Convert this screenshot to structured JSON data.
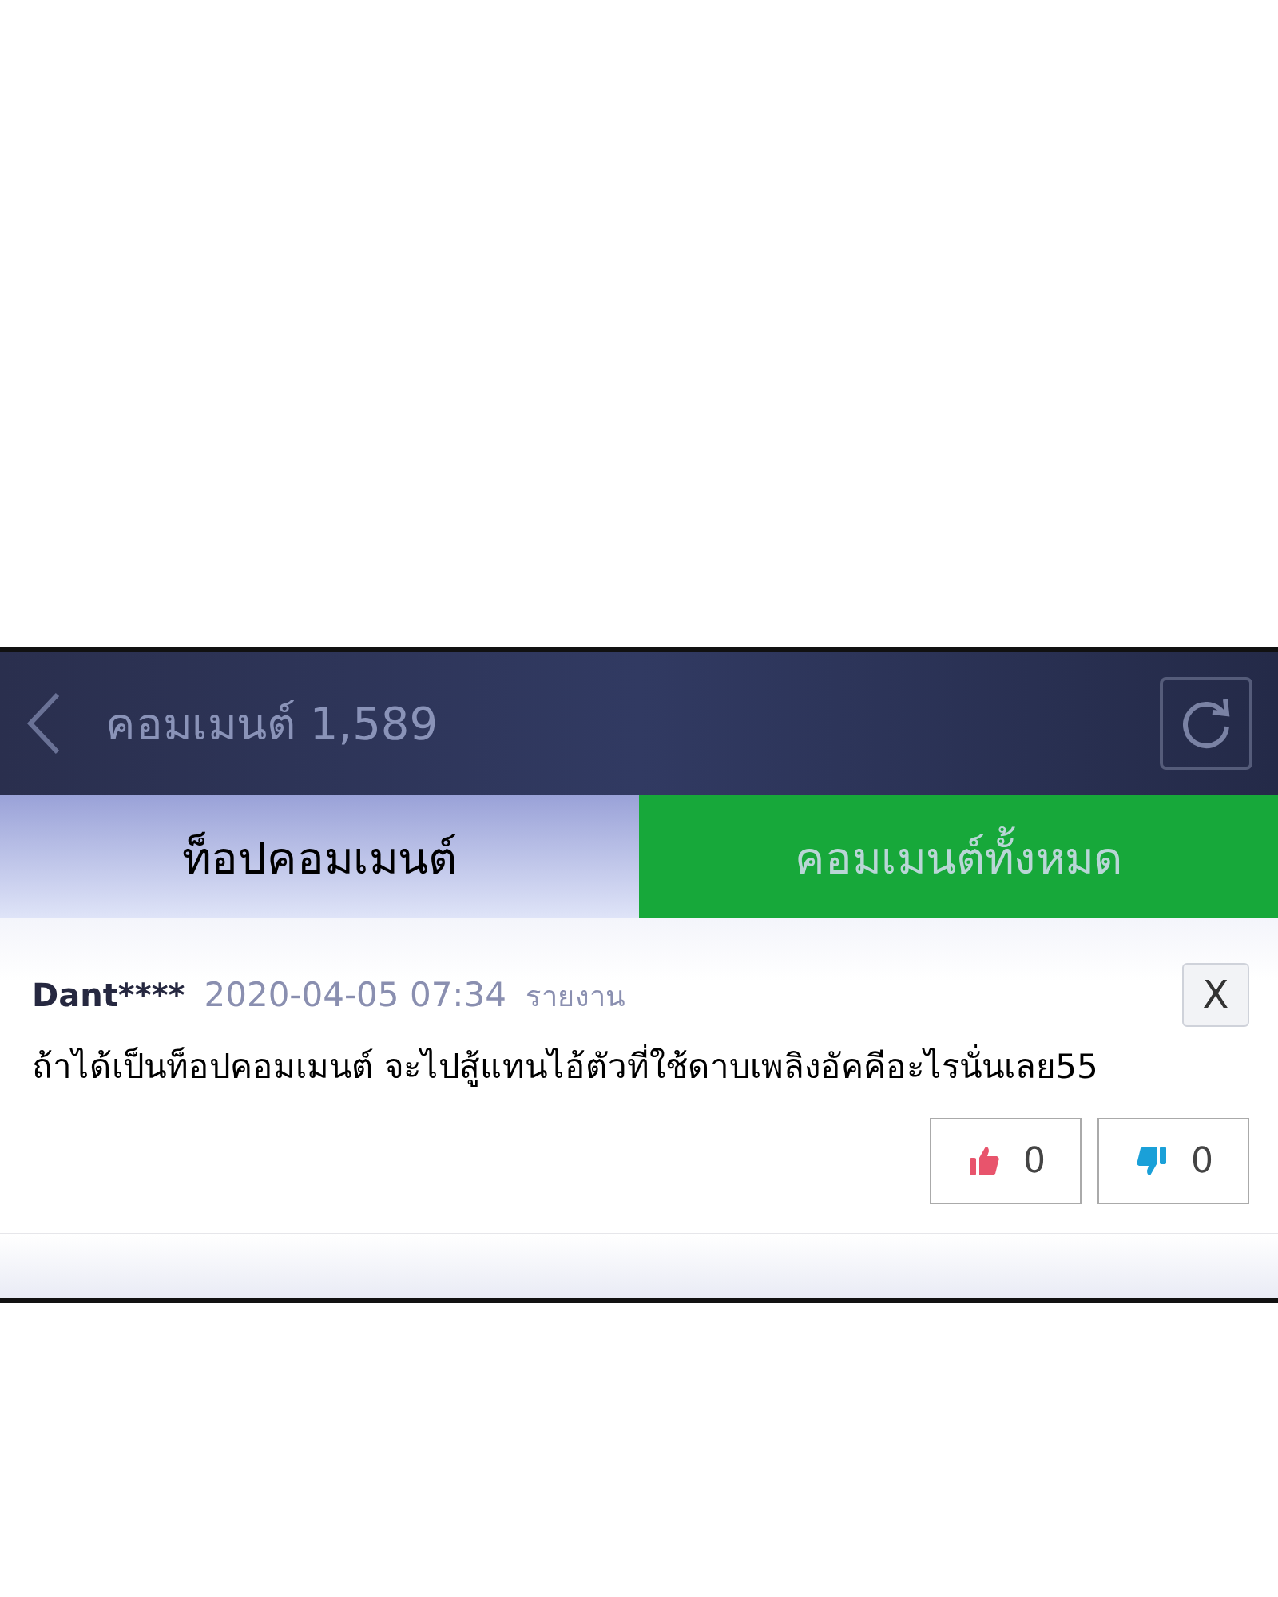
{
  "header": {
    "title": "คอมเมนต์ 1,589"
  },
  "tabs": [
    {
      "label": "ท็อปคอมเมนต์",
      "selected": false
    },
    {
      "label": "คอมเมนต์ทั้งหมด",
      "selected": true
    }
  ],
  "comments": [
    {
      "author": "Dant****",
      "date": "2020-04-05 07:34",
      "report": "รายงาน",
      "close": "X",
      "text": "ถ้าได้เป็นท็อปคอมเมนต์ จะไปสู้แทนไอ้ตัวที่ใช้ดาบเพลิงอัคคีอะไรนั่นเลย55",
      "likes": "0",
      "dislikes": "0"
    }
  ]
}
